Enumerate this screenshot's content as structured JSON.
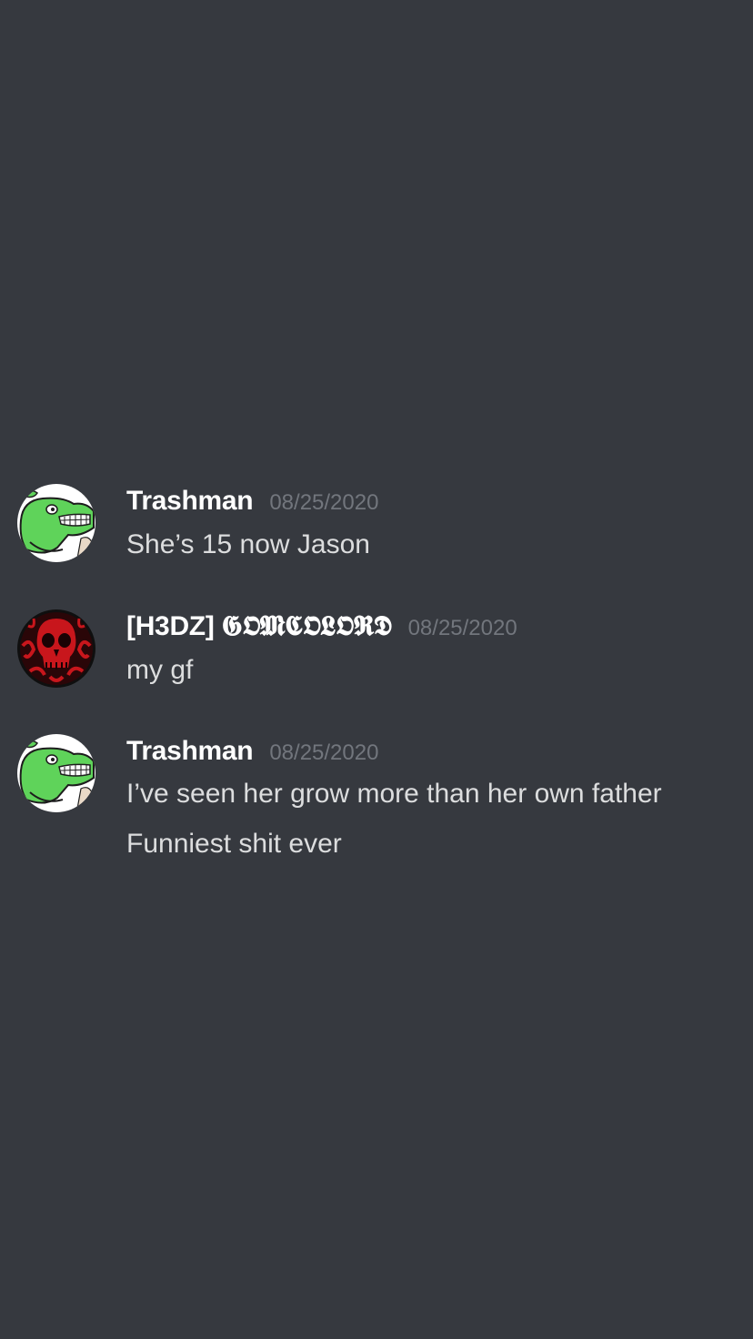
{
  "messages": [
    {
      "author": "Trashman",
      "timestamp": "08/25/2020",
      "avatar_icon": "green-creature-avatar-icon",
      "lines": [
        "She’s 15 now Jason"
      ]
    },
    {
      "author": "[H3DZ] 𝕲𝕺𝕸𝕮𝕺𝕷𝕺𝕽𝕯",
      "timestamp": "08/25/2020",
      "avatar_icon": "red-skull-avatar-icon",
      "lines": [
        "my gf"
      ]
    },
    {
      "author": "Trashman",
      "timestamp": "08/25/2020",
      "avatar_icon": "green-creature-avatar-icon",
      "lines": [
        "I’ve seen her grow more than her own father",
        "Funniest shit ever"
      ]
    }
  ],
  "colors": {
    "background": "#36393f",
    "username": "#ffffff",
    "timestamp": "#72767d",
    "message_text": "#dcddde",
    "avatar_green": "#5fd35a",
    "avatar_red": "#c8161c"
  }
}
